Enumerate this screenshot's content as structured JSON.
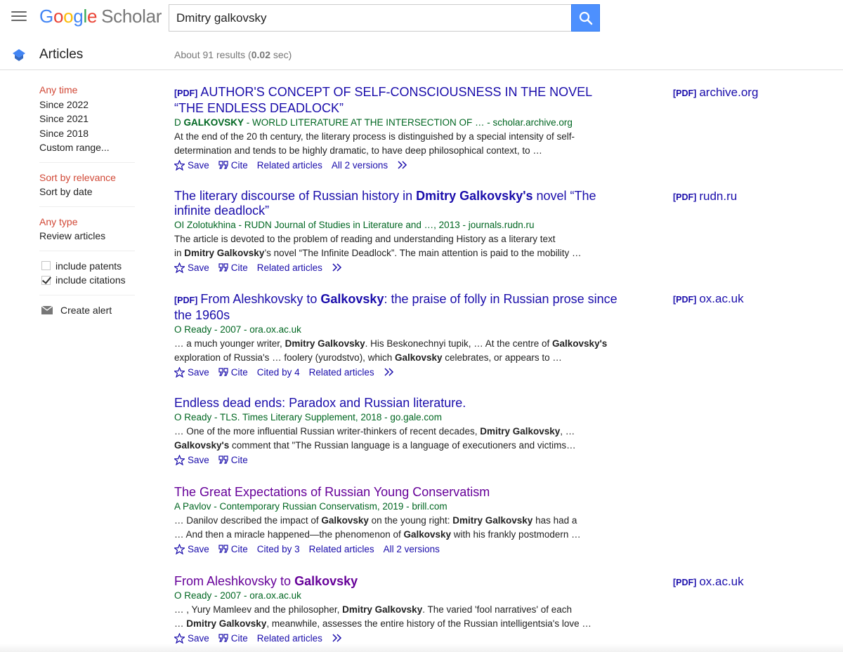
{
  "logo": {
    "g1": "G",
    "o1": "o",
    "o2": "o",
    "g2": "g",
    "l": "l",
    "e": "e",
    "suffix": "Scholar"
  },
  "search": {
    "query": "Dmitry galkovsky"
  },
  "subheader": {
    "title": "Articles",
    "results_prefix": "About 91 results (",
    "results_time": "0.02",
    "results_suffix": " sec)"
  },
  "sidebar": {
    "time": [
      "Any time",
      "Since 2022",
      "Since 2021",
      "Since 2018",
      "Custom range..."
    ],
    "sort": [
      "Sort by relevance",
      "Sort by date"
    ],
    "type": [
      "Any type",
      "Review articles"
    ],
    "include_patents": "include patents",
    "include_citations": "include citations",
    "create_alert": "Create alert"
  },
  "labels": {
    "pdf": "[PDF]",
    "save": "Save",
    "cite": "Cite"
  },
  "results": [
    {
      "title_a": "AUTHOR'S CONCEPT OF SELF-CONSCIOUSNESS IN THE NOVEL “THE ENDLESS DEADLOCK”",
      "meta_a": "D ",
      "meta_b": "GALKOVSKY",
      "meta_c": " - WORLD LITERATURE AT THE INTERSECTION OF … - scholar.archive.org",
      "snippet": "At the end of the 20 th century, the literary process is distinguished by a special intensity of self-determination and tends to be highly dramatic, to have deep philosophical context, to …",
      "related": "Related articles",
      "versions": "All 2 versions",
      "side_domain": "archive.org"
    },
    {
      "title_a": "The literary discourse of Russian history in ",
      "title_b": "Dmitry Galkovsky's",
      "title_c": " novel “The infinite deadlock”",
      "meta": "OI Zolotukhina - RUDN Journal of Studies in Literature and …, 2013 - journals.rudn.ru",
      "snip1": "The article is devoted to the problem of reading and understanding History as a literary text",
      "snip2a": "in ",
      "snip2b": "Dmitry Galkovsky",
      "snip2c": "’s novel “The Infinite Deadlock”. The main attention is paid to the mobility …",
      "related": "Related articles",
      "side_domain": "rudn.ru"
    },
    {
      "title_a": "From Aleshkovsky to ",
      "title_b": "Galkovsky",
      "title_c": ": the praise of folly in Russian prose since the 1960s",
      "meta": "O Ready - 2007 - ora.ox.ac.uk",
      "snip1a": "… a much younger writer, ",
      "snip1b": "Dmitry Galkovsky",
      "snip1c": ". His Beskonechnyi tupik, … At the centre of ",
      "snip1d": "Galkovsky's",
      "snip2a": "exploration of Russia's … foolery (yurodstvo), which ",
      "snip2b": "Galkovsky",
      "snip2c": " celebrates, or appears to …",
      "cited": "Cited by 4",
      "related": "Related articles",
      "side_domain": "ox.ac.uk"
    },
    {
      "title": "Endless dead ends: Paradox and Russian literature.",
      "meta": "O Ready - TLS. Times Literary Supplement, 2018 - go.gale.com",
      "snip1a": "… One of the more influential Russian writer-thinkers of recent decades, ",
      "snip1b": "Dmitry Galkovsky",
      "snip1c": ", …",
      "snip2a": "Galkovsky's",
      "snip2b": " comment that \"The Russian language is a language of executioners and victims…"
    },
    {
      "title": "The Great Expectations of Russian Young Conservatism",
      "meta": "A Pavlov - Contemporary Russian Conservatism, 2019 - brill.com",
      "snip1a": "… Danilov described the impact of ",
      "snip1b": "Galkovsky",
      "snip1c": " on the young right: ",
      "snip1d": "Dmitry Galkovsky",
      "snip1e": " has had a",
      "snip2a": "… And then a miracle happened—the phenomenon of ",
      "snip2b": "Galkovsky",
      "snip2c": " with his frankly postmodern …",
      "cited": "Cited by 3",
      "related": "Related articles",
      "versions": "All 2 versions"
    },
    {
      "title_a": "From Aleshkovsky to ",
      "title_b": "Galkovsky",
      "meta": "O Ready - 2007 - ora.ox.ac.uk",
      "snip1a": "… , Yury Mamleev and the philosopher, ",
      "snip1b": "Dmitry Galkovsky",
      "snip1c": ". The varied 'fool narratives' of each",
      "snip2a": "… ",
      "snip2b": "Dmitry Galkovsky",
      "snip2c": ", meanwhile, assesses the entire history of the Russian intelligentsia's love …",
      "related": "Related articles",
      "side_domain": "ox.ac.uk"
    }
  ],
  "colors": {
    "link": "#1a0dab",
    "visited": "#660099",
    "meta_green": "#006621",
    "active_red": "#d14836",
    "search_blue": "#4d90fe"
  }
}
